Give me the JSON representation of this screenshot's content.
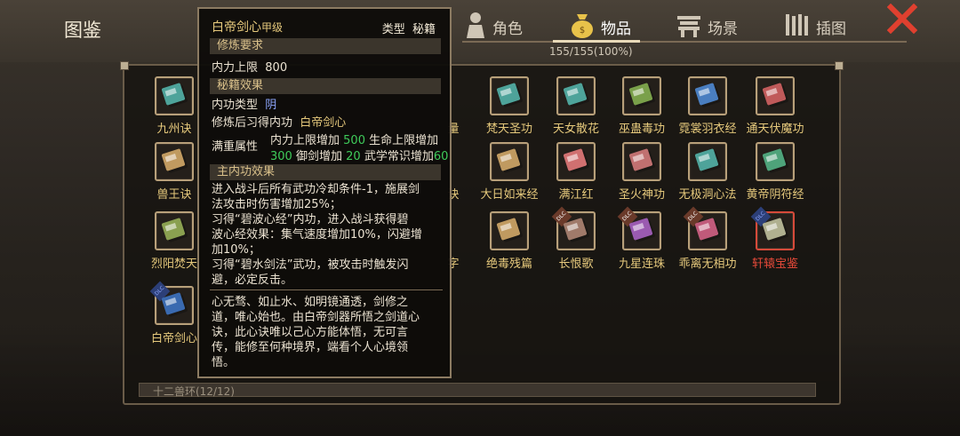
{
  "header": {
    "title": "图鉴",
    "tabs": [
      {
        "label": "角色",
        "icon": "person-icon"
      },
      {
        "label": "物品",
        "icon": "bag-icon",
        "active": true
      },
      {
        "label": "场景",
        "icon": "building-icon"
      },
      {
        "label": "插图",
        "icon": "scroll-icon"
      }
    ],
    "count": "155/155(100%)"
  },
  "grid": {
    "row1": [
      "九州诀",
      "梵天圣功",
      "天女散花",
      "巫蛊毒功",
      "霓裳羽衣经",
      "通天伏魔功"
    ],
    "row2": [
      "兽王诀",
      "大日如来经",
      "满江红",
      "圣火神功",
      "无极洞心法",
      "黄帝阴符经"
    ],
    "row3": [
      "烈阳焚天",
      "绝毒残篇",
      "长恨歌",
      "九星连珠",
      "乖离无相功",
      "轩辕宝鉴"
    ],
    "row4": [
      "白帝剑心"
    ],
    "partial": [
      "量",
      "诀",
      "字"
    ],
    "bottom_text": "十二兽环(12/12)"
  },
  "tooltip": {
    "name": "白帝剑心",
    "grade": "甲级",
    "type_label": "类型",
    "type_value": "秘籍",
    "sec1": "修炼要求",
    "req_label": "内力上限",
    "req_value": "800",
    "sec2": "秘籍效果",
    "ngtype_label": "内功类型",
    "ngtype_value": "阴",
    "learn_label": "修炼后习得内功",
    "learn_value": "白帝剑心",
    "full_label": "满重属性",
    "full_l1a": "内力上限增加",
    "full_l1b": "500",
    "full_l1c": "生命上限增加",
    "full_l2a": "300",
    "full_l2b": "御剑增加",
    "full_l2c": "20",
    "full_l2d": "武学常识增加",
    "full_l2e": "60",
    "sec3": "主内功效果",
    "effect": [
      "进入战斗后所有武功冷却条件-1，施展剑",
      "法攻击时伤害增加25%；",
      "习得“碧波心经”内功，进入战斗获得碧",
      "波心经效果：集气速度增加10%，闪避增",
      "加10%；",
      "习得“碧水剑法”武功，被攻击时触发闪",
      "避，必定反击。"
    ],
    "desc": [
      "心无骛、如止水、如明镜通透，剑修之",
      "道，唯心始也。由白帝剑器所悟之剑道心",
      "诀，此心诀唯以己心方能体悟，无可言",
      "传，能修至何种境界，端看个人心境领",
      "悟。"
    ]
  },
  "colors": {
    "accent": "#e6c97c",
    "green": "#3fcb5a",
    "red": "#e84a3a",
    "close": "#e0402f"
  }
}
